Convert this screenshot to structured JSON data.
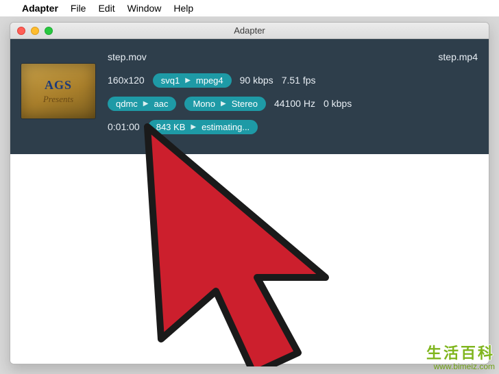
{
  "menubar": {
    "app": "Adapter",
    "items": [
      "File",
      "Edit",
      "Window",
      "Help"
    ]
  },
  "window": {
    "title": "Adapter"
  },
  "job": {
    "src_file": "step.mov",
    "dst_file": "step.mp4",
    "thumb": {
      "line1": "AGS",
      "line2": "Presents"
    },
    "video": {
      "resolution": "160x120",
      "codec_from": "svq1",
      "codec_to": "mpeg4",
      "bitrate": "90 kbps",
      "fps": "7.51 fps"
    },
    "audio": {
      "codec_from": "qdmc",
      "codec_to": "aac",
      "channels_from": "Mono",
      "channels_to": "Stereo",
      "sample_rate": "44100 Hz",
      "bitrate": "0 kbps"
    },
    "progress": {
      "duration": "0:01:00",
      "size": "843 KB",
      "status": "estimating..."
    }
  },
  "watermark": {
    "line1": "生活百科",
    "line2": "www.bimeiz.com"
  }
}
